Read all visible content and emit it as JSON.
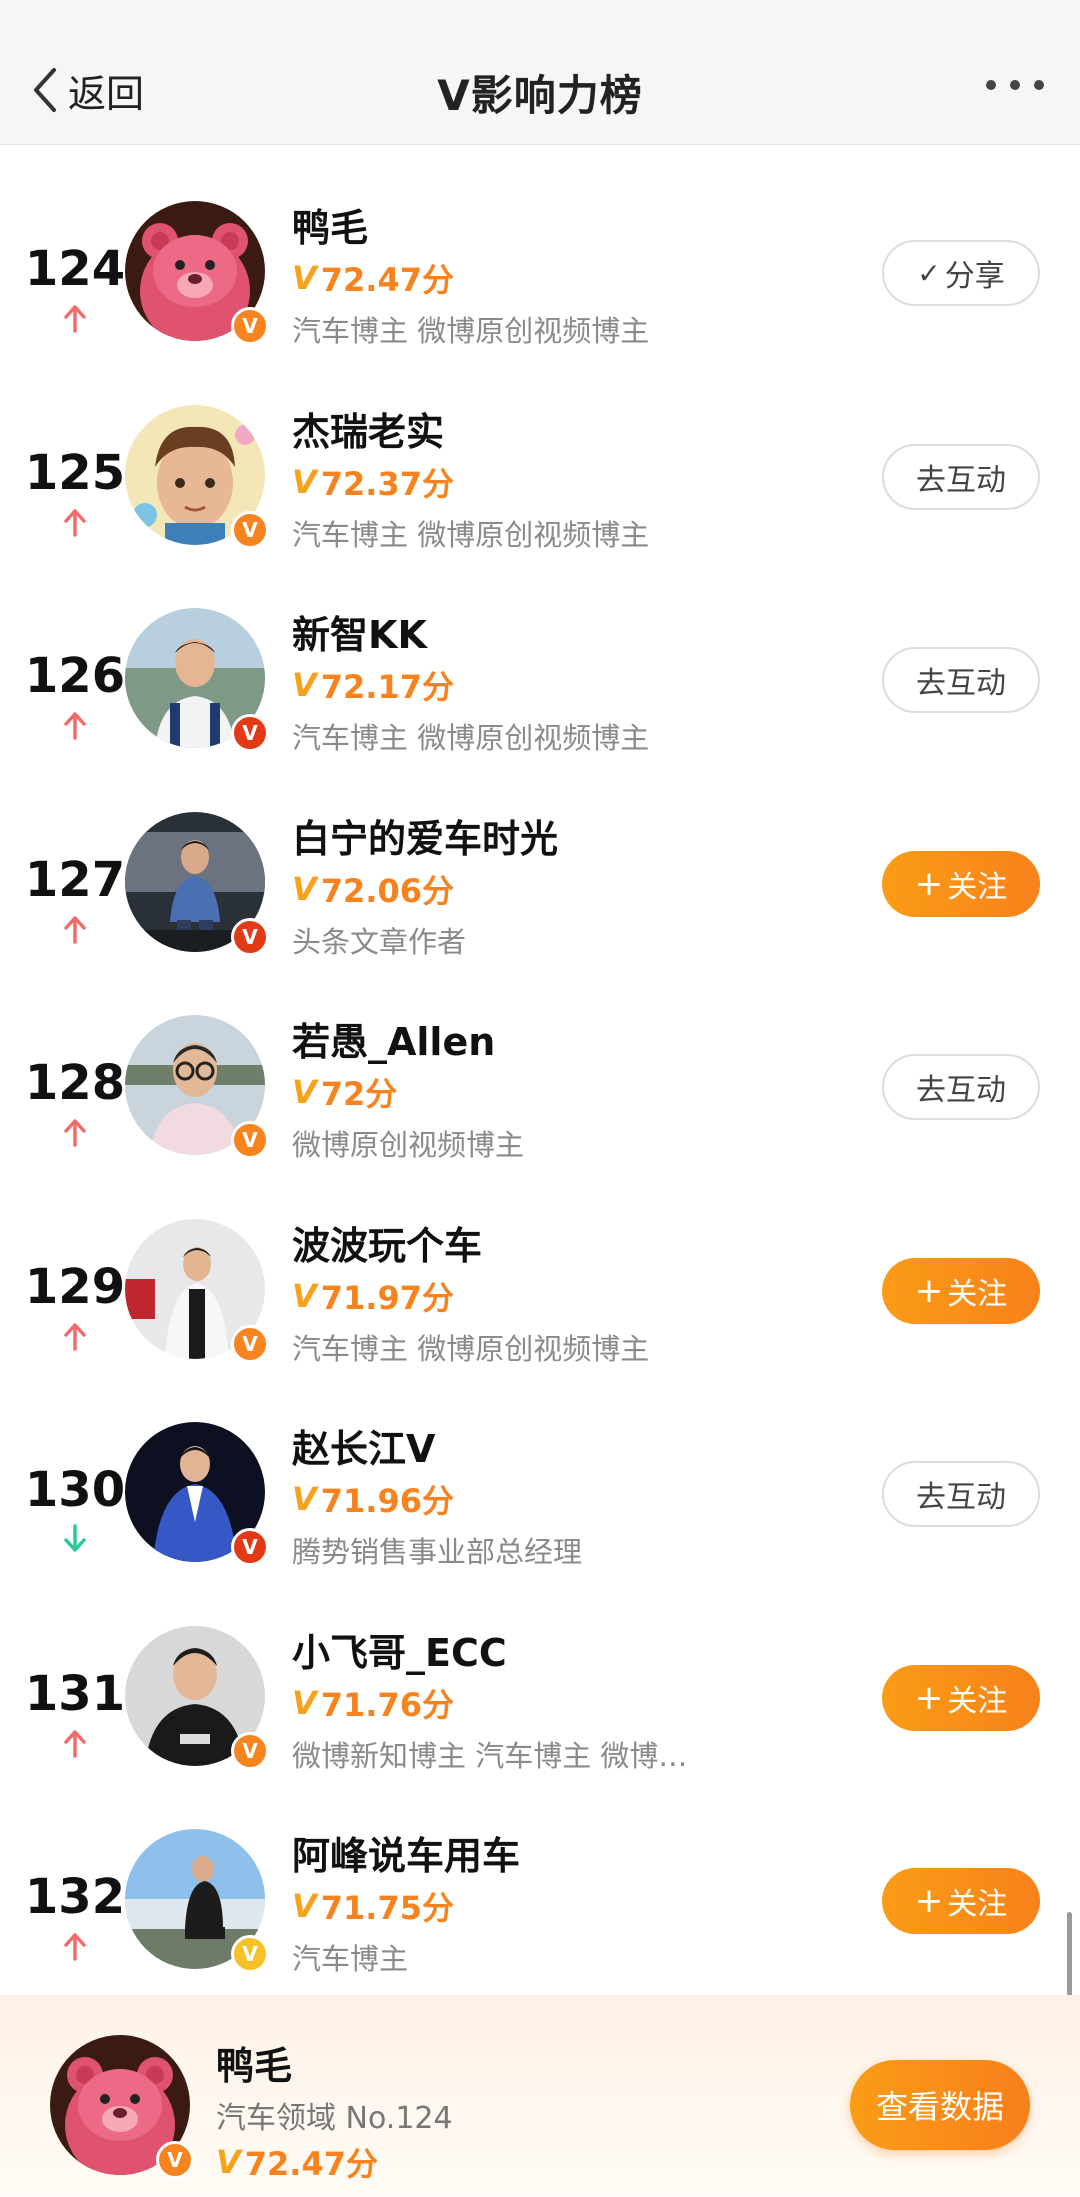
{
  "header": {
    "back_label": "返回",
    "title": "V影响力榜",
    "more_icon": "more-dots-icon"
  },
  "list": [
    {
      "rank": "124",
      "trend": "up",
      "name": "鸭毛",
      "score": "72.47分",
      "desc": "汽车博主 微博原创视频博主",
      "button": "分享",
      "button_style": "outline-check",
      "badge": "orange",
      "avatar_icon": "pink-bear-avatar"
    },
    {
      "rank": "125",
      "trend": "up",
      "name": "杰瑞老实",
      "score": "72.37分",
      "desc": "汽车博主 微博原创视频博主",
      "button": "去互动",
      "button_style": "outline",
      "badge": "orange",
      "avatar_icon": "cartoon-boy-avatar"
    },
    {
      "rank": "126",
      "trend": "up",
      "name": "新智KK",
      "score": "72.17分",
      "desc": "汽车博主 微博原创视频博主",
      "button": "去互动",
      "button_style": "outline",
      "badge": "red",
      "avatar_icon": "man-outdoor-avatar"
    },
    {
      "rank": "127",
      "trend": "up",
      "name": "白宁的爱车时光",
      "score": "72.06分",
      "desc": "头条文章作者",
      "button": "关注",
      "button_style": "fill",
      "badge": "red",
      "avatar_icon": "man-in-car-avatar"
    },
    {
      "rank": "128",
      "trend": "up",
      "name": "若愚_Allen",
      "score": "72分",
      "desc": "微博原创视频博主",
      "button": "去互动",
      "button_style": "outline",
      "badge": "orange",
      "avatar_icon": "man-glasses-avatar"
    },
    {
      "rank": "129",
      "trend": "up",
      "name": "波波玩个车",
      "score": "71.97分",
      "desc": "汽车博主 微博原创视频博主",
      "button": "关注",
      "button_style": "fill",
      "badge": "orange",
      "avatar_icon": "man-white-jacket-avatar"
    },
    {
      "rank": "130",
      "trend": "down",
      "name": "赵长江V",
      "score": "71.96分",
      "desc": "腾势销售事业部总经理",
      "button": "去互动",
      "button_style": "outline",
      "badge": "red",
      "avatar_icon": "man-blue-suit-avatar"
    },
    {
      "rank": "131",
      "trend": "up",
      "name": "小飞哥_ECC",
      "score": "71.76分",
      "desc": "微博新知博主 汽车博主 微博…",
      "button": "关注",
      "button_style": "fill",
      "badge": "orange",
      "avatar_icon": "man-black-hoodie-avatar"
    },
    {
      "rank": "132",
      "trend": "up",
      "name": "阿峰说车用车",
      "score": "71.75分",
      "desc": "汽车博主",
      "button": "关注",
      "button_style": "fill",
      "badge": "yellow",
      "avatar_icon": "man-sitting-outdoor-avatar"
    }
  ],
  "me": {
    "name": "鸭毛",
    "desc": "汽车领域 No.124",
    "score": "72.47分",
    "button": "查看数据",
    "avatar_icon": "pink-bear-avatar"
  },
  "colors": {
    "accent": "#f7821e",
    "up": "#f26b6b",
    "down": "#2cc79b"
  },
  "score_prefix": "V",
  "plus_glyph": "+",
  "check_glyph": "✓"
}
